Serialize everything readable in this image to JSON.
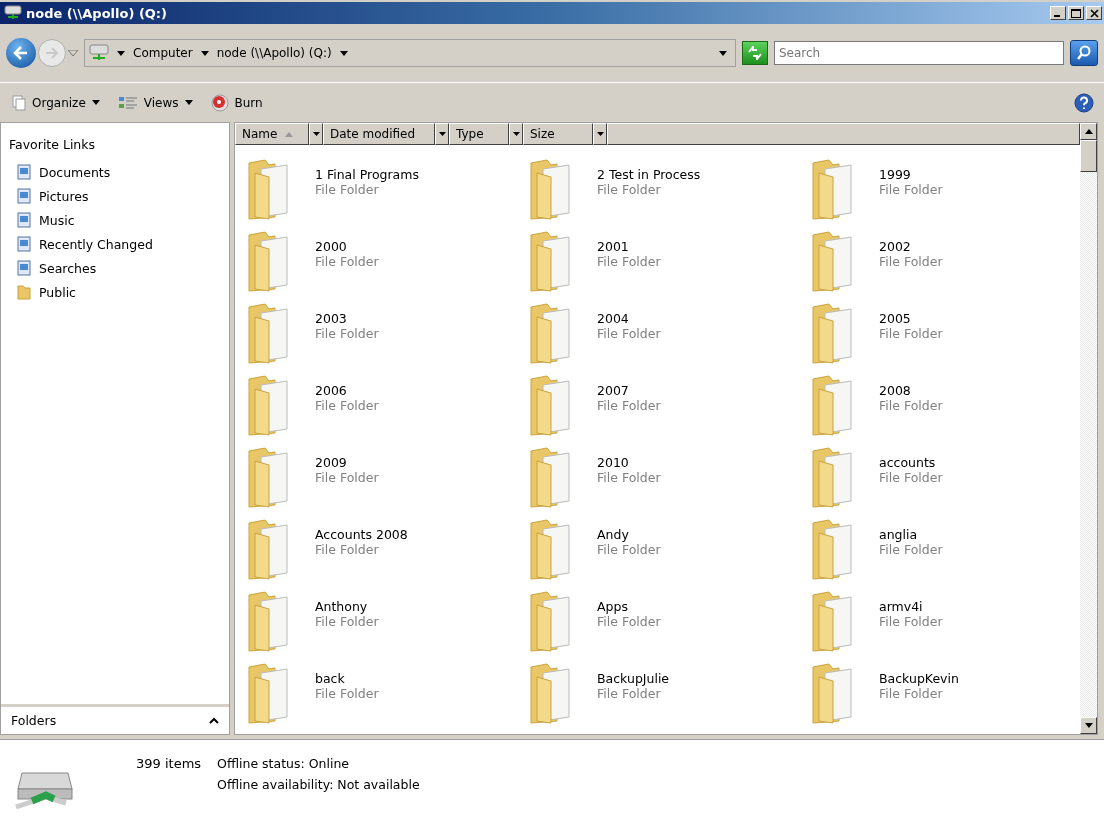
{
  "window": {
    "title": "node (\\\\Apollo) (Q:)"
  },
  "address_bar": {
    "crumbs": [
      "Computer",
      "node (\\\\Apollo) (Q:)"
    ]
  },
  "search": {
    "placeholder": "Search"
  },
  "toolbar": [
    {
      "label": "Organize",
      "kind": "organize"
    },
    {
      "label": "Views",
      "kind": "views"
    },
    {
      "label": "Burn",
      "kind": "burn"
    }
  ],
  "sidebar": {
    "title": "Favorite Links",
    "items": [
      {
        "label": "Documents",
        "kind": "page"
      },
      {
        "label": "Pictures",
        "kind": "page"
      },
      {
        "label": "Music",
        "kind": "page"
      },
      {
        "label": "Recently Changed",
        "kind": "page"
      },
      {
        "label": "Searches",
        "kind": "page"
      },
      {
        "label": "Public",
        "kind": "folder"
      }
    ],
    "folders_label": "Folders"
  },
  "columns": [
    {
      "label": "Name",
      "sorted": true
    },
    {
      "label": "Date modified",
      "sorted": false
    },
    {
      "label": "Type",
      "sorted": false
    },
    {
      "label": "Size",
      "sorted": false
    }
  ],
  "items": [
    {
      "name": "1 Final Programs",
      "type": "File Folder"
    },
    {
      "name": "2 Test in Process",
      "type": "File Folder"
    },
    {
      "name": "1999",
      "type": "File Folder"
    },
    {
      "name": "2000",
      "type": "File Folder"
    },
    {
      "name": "2001",
      "type": "File Folder"
    },
    {
      "name": "2002",
      "type": "File Folder"
    },
    {
      "name": "2003",
      "type": "File Folder"
    },
    {
      "name": "2004",
      "type": "File Folder"
    },
    {
      "name": "2005",
      "type": "File Folder"
    },
    {
      "name": "2006",
      "type": "File Folder"
    },
    {
      "name": "2007",
      "type": "File Folder"
    },
    {
      "name": "2008",
      "type": "File Folder"
    },
    {
      "name": "2009",
      "type": "File Folder"
    },
    {
      "name": "2010",
      "type": "File Folder"
    },
    {
      "name": "accounts",
      "type": "File Folder"
    },
    {
      "name": "Accounts 2008",
      "type": "File Folder"
    },
    {
      "name": "Andy",
      "type": "File Folder"
    },
    {
      "name": "anglia",
      "type": "File Folder"
    },
    {
      "name": "Anthony",
      "type": "File Folder"
    },
    {
      "name": "Apps",
      "type": "File Folder"
    },
    {
      "name": "armv4i",
      "type": "File Folder"
    },
    {
      "name": "back",
      "type": "File Folder"
    },
    {
      "name": "BackupJulie",
      "type": "File Folder"
    },
    {
      "name": "BackupKevin",
      "type": "File Folder"
    }
  ],
  "status_bar": {
    "count": "399 items",
    "offline_status": "Offline status: Online",
    "offline_availability": "Offline availability: Not available"
  }
}
